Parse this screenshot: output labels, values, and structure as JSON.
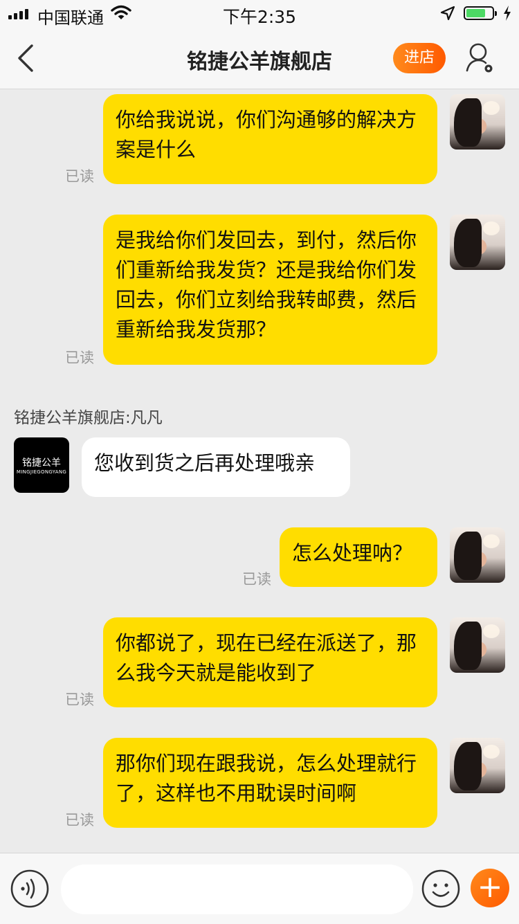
{
  "status_bar": {
    "carrier": "中国联通",
    "time": "下午2:35",
    "battery_level": 0.75
  },
  "header": {
    "title": "铭捷公羊旗舰店",
    "enter_store_label": "进店"
  },
  "shop": {
    "sender_label": "铭捷公羊旗舰店:凡凡",
    "logo_text": "铭捷公羊",
    "logo_subtext": "MINGJIEGONGYANG"
  },
  "messages": [
    {
      "from": "me",
      "read": "已读",
      "text": "你给我说说，你们沟通够的解决方案是什么"
    },
    {
      "from": "me",
      "read": "已读",
      "text": "是我给你们发回去，到付，然后你们重新给我发货？还是我给你们发回去，你们立刻给我转邮费，然后重新给我发货那？"
    },
    {
      "from": "shop",
      "text": "您收到货之后再处理哦亲"
    },
    {
      "from": "me",
      "read": "已读",
      "text": "怎么处理呐？"
    },
    {
      "from": "me",
      "read": "已读",
      "text": "你都说了，现在已经在派送了，那么我今天就是能收到了"
    },
    {
      "from": "me",
      "read": "已读",
      "text": "那你们现在跟我说，怎么处理就行了，这样也不用耽误时间啊"
    }
  ],
  "input_bar": {
    "placeholder": "",
    "plus_label": "+"
  },
  "colors": {
    "my_bubble": "#ffdd00",
    "shop_bubble": "#ffffff",
    "accent": "#ff6a00",
    "background": "#ebebeb"
  },
  "icons": [
    "back-arrow-icon",
    "user-settings-icon",
    "voice-icon",
    "emoji-icon",
    "plus-icon",
    "wifi-icon",
    "location-arrow-icon",
    "battery-icon",
    "charging-bolt-icon"
  ]
}
